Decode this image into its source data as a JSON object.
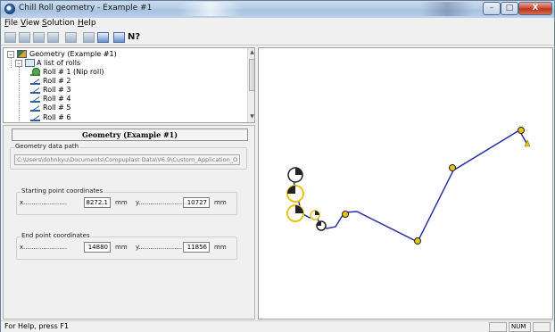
{
  "window": {
    "title": "Chill Roll geometry - Example #1",
    "buttons": {
      "minimize": "–",
      "maximize": "□",
      "close": "X"
    }
  },
  "menu": [
    {
      "accel": "F",
      "rest": "ile"
    },
    {
      "accel": "V",
      "rest": "iew"
    },
    {
      "accel": "S",
      "rest": "olution"
    },
    {
      "accel": "H",
      "rest": "elp"
    }
  ],
  "toolbar": {
    "icons": [
      "open-icon",
      "save-icon",
      "edit-icon",
      "print-icon",
      "grid-icon",
      "chart-icon",
      "table-icon",
      "about-icon",
      "context-help-icon"
    ],
    "help_glyph": "N?"
  },
  "tree": {
    "expand_glyph": "–",
    "root": "Geometry (Example #1)",
    "list": "A list of rolls",
    "rolls": [
      "Roll #  1 (Nip roll)",
      "Roll #  2",
      "Roll #  3",
      "Roll #  4",
      "Roll #  5",
      "Roll #  6"
    ]
  },
  "properties": {
    "header": "Geometry (Example #1)",
    "path_group": "Geometry data path",
    "path_value": "C:\\Users\\dohnkyu\\Documents\\Compuplast Data\\V6.9\\Custom_Application_O",
    "start_group": "Starting point coordinates",
    "end_group": "End point coordinates",
    "x_label": "x......................",
    "y_label": "y......................",
    "unit": "mm",
    "start": {
      "x": "8272.1",
      "y": "10727"
    },
    "end": {
      "x": "14880",
      "y": "11856"
    }
  },
  "status": {
    "text": "For Help, press F1",
    "num": "NUM"
  },
  "colors": {
    "path_line": "#1f2aa0",
    "roll_yellow": "#e8c21a",
    "roll_dark": "#222222"
  }
}
